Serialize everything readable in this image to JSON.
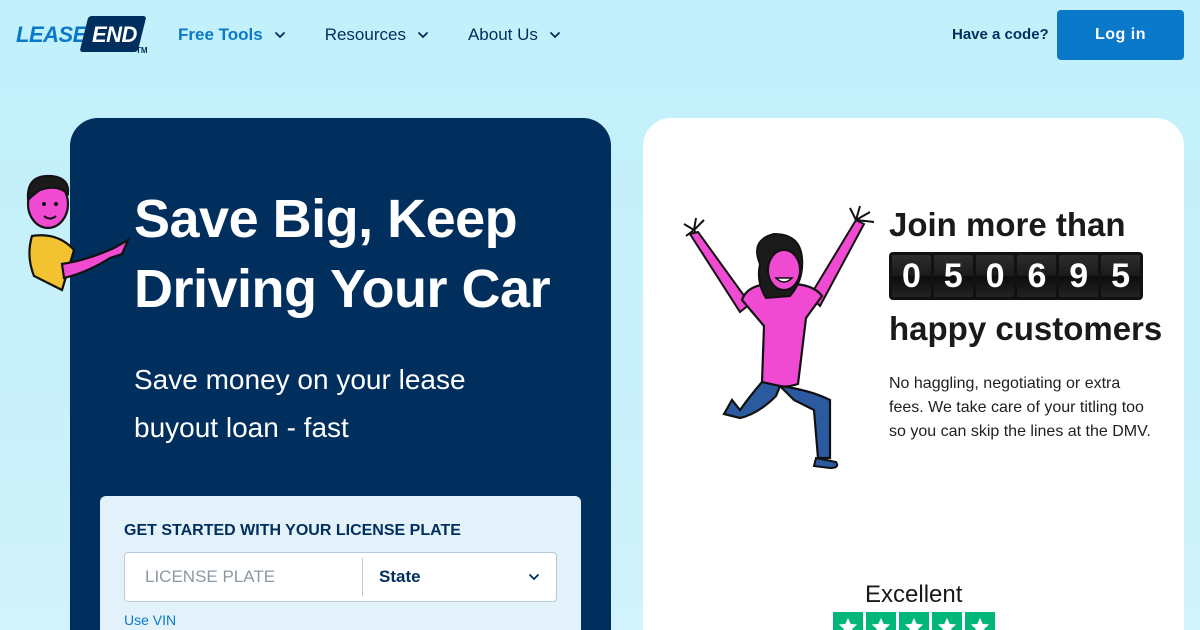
{
  "header": {
    "logo": {
      "part1": "LEASE",
      "part2": "END",
      "tm": "TM"
    },
    "nav": [
      {
        "label": "Free Tools",
        "active": true
      },
      {
        "label": "Resources",
        "active": false
      },
      {
        "label": "About Us",
        "active": false
      }
    ],
    "have_code": "Have a code?",
    "login": "Log in"
  },
  "hero": {
    "title": "Save Big, Keep Driving Your Car",
    "subtitle": "Save money on your lease buyout loan - fast"
  },
  "plate_form": {
    "label": "GET STARTED WITH YOUR LICENSE PLATE",
    "plate_placeholder": "LICENSE PLATE",
    "state_value": "State",
    "use_vin": "Use VIN"
  },
  "customers": {
    "join": "Join more than",
    "digits": [
      "0",
      "5",
      "0",
      "6",
      "9",
      "5"
    ],
    "happy": "happy customers",
    "description": "No haggling, negotiating or extra fees. We take care of your titling too so you can skip the lines at the DMV."
  },
  "rating": {
    "label": "Excellent",
    "stars": 5
  },
  "colors": {
    "brand_blue": "#0b79c9",
    "navy": "#002e5d",
    "trustpilot_green": "#00b67a"
  }
}
